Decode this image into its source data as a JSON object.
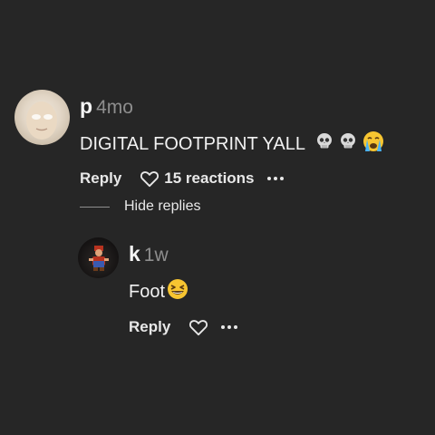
{
  "comment": {
    "username": "p",
    "timestamp": "4mo",
    "text": "DIGITAL FOOTPRINT YALL",
    "emojis": [
      "skull-emoji",
      "skull-emoji",
      "loudly-crying-face-emoji"
    ],
    "reply_label": "Reply",
    "reactions_label": "15 reactions",
    "hide_replies_label": "Hide replies"
  },
  "reply": {
    "username": "k",
    "timestamp": "1w",
    "text": "Foot",
    "emojis": [
      "grinning-squinting-face-emoji"
    ],
    "reply_label": "Reply"
  },
  "colors": {
    "background": "#262626",
    "text_primary": "#f2f2f2",
    "text_secondary": "#8e8e8e"
  }
}
